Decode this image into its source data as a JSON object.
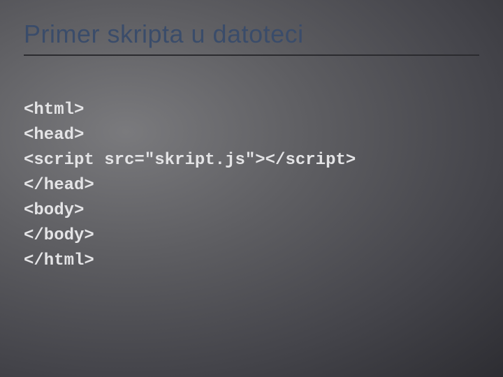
{
  "slide": {
    "title": "Primer skripta u datoteci",
    "code_lines": {
      "l1": "<html>",
      "l2": "<head>",
      "l3": "<script src=\"skript.js\"></script>",
      "l4": "</head>",
      "l5": "<body>",
      "l6": "</body>",
      "l7": "</html>"
    }
  }
}
